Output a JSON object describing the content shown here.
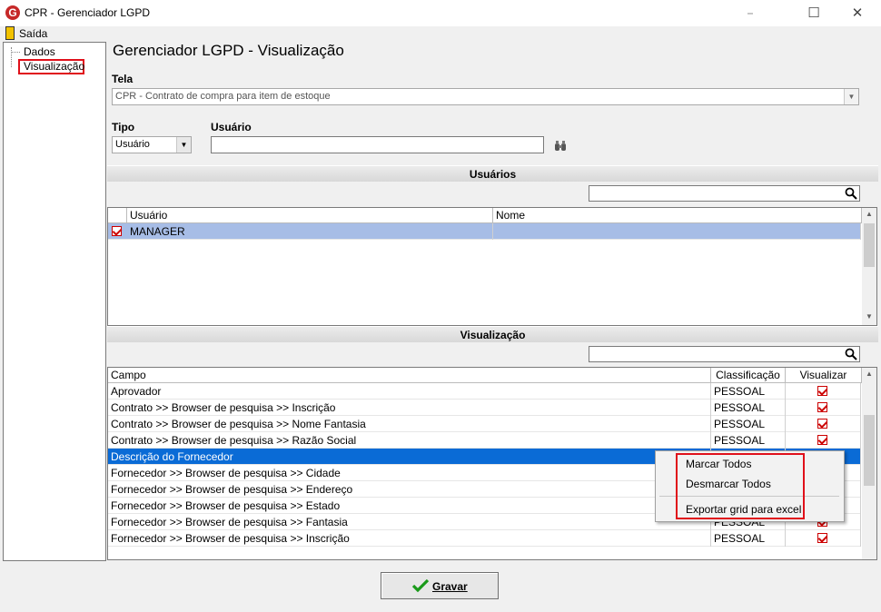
{
  "window": {
    "title": "CPR - Gerenciador LGPD",
    "icon_letter": "G"
  },
  "menu": {
    "exit_label": "Saída"
  },
  "tree": {
    "items": [
      {
        "label": "Dados"
      },
      {
        "label": "Visualização"
      }
    ]
  },
  "main": {
    "title": "Gerenciador LGPD - Visualização",
    "tela_label": "Tela",
    "tela_value": "CPR - Contrato de compra para item de estoque",
    "tipo_label": "Tipo",
    "tipo_value": "Usuário",
    "usuario_label": "Usuário",
    "usuario_value": ""
  },
  "users_section": {
    "title": "Usuários",
    "columns": [
      "Usuário",
      "Nome"
    ],
    "rows": [
      {
        "checked": true,
        "usuario": "MANAGER",
        "nome": ""
      }
    ]
  },
  "vis_section": {
    "title": "Visualização",
    "columns": [
      "Campo",
      "Classificação",
      "Visualizar"
    ],
    "rows": [
      {
        "campo": "Aprovador",
        "classificacao": "PESSOAL",
        "visualizar": true
      },
      {
        "campo": "Contrato >> Browser de pesquisa >> Inscrição",
        "classificacao": "PESSOAL",
        "visualizar": true
      },
      {
        "campo": "Contrato >> Browser de pesquisa >> Nome Fantasia",
        "classificacao": "PESSOAL",
        "visualizar": true
      },
      {
        "campo": "Contrato >> Browser de pesquisa >> Razão Social",
        "classificacao": "PESSOAL",
        "visualizar": true
      },
      {
        "campo": "Descrição do Fornecedor",
        "classificacao": "",
        "visualizar": true
      },
      {
        "campo": "Fornecedor >> Browser de pesquisa >> Cidade",
        "classificacao": "",
        "visualizar": true
      },
      {
        "campo": "Fornecedor >> Browser de pesquisa >> Endereço",
        "classificacao": "",
        "visualizar": true
      },
      {
        "campo": "Fornecedor >> Browser de pesquisa >> Estado",
        "classificacao": "",
        "visualizar": true
      },
      {
        "campo": "Fornecedor >> Browser de pesquisa >> Fantasia",
        "classificacao": "PESSOAL",
        "visualizar": true
      },
      {
        "campo": "Fornecedor >> Browser de pesquisa >> Inscrição",
        "classificacao": "PESSOAL",
        "visualizar": true
      }
    ]
  },
  "context_menu": {
    "items": [
      "Marcar Todos",
      "Desmarcar Todos",
      "Exportar grid para excel"
    ]
  },
  "save_button": {
    "label": "Gravar"
  },
  "colors": {
    "selection": "#0a6bd6",
    "highlight_border": "#e0101a",
    "check": "#cc0000"
  }
}
